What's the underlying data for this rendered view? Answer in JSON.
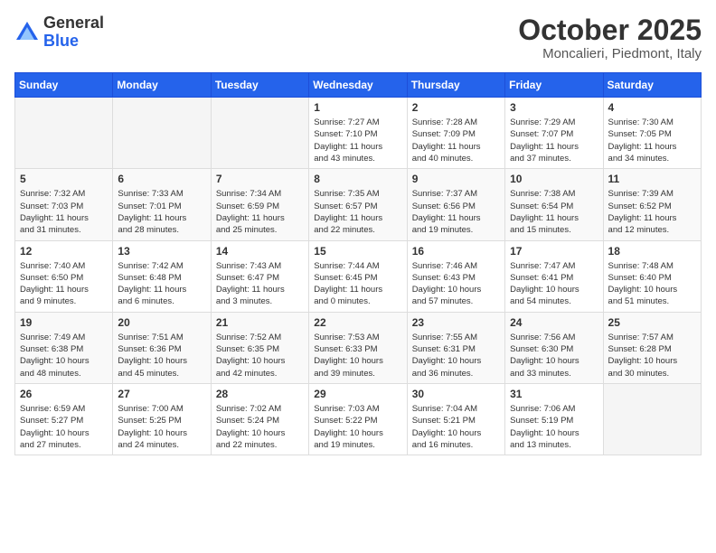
{
  "header": {
    "logo": {
      "general": "General",
      "blue": "Blue"
    },
    "title": "October 2025",
    "subtitle": "Moncalieri, Piedmont, Italy"
  },
  "days_of_week": [
    "Sunday",
    "Monday",
    "Tuesday",
    "Wednesday",
    "Thursday",
    "Friday",
    "Saturday"
  ],
  "weeks": [
    [
      {
        "day": "",
        "info": ""
      },
      {
        "day": "",
        "info": ""
      },
      {
        "day": "",
        "info": ""
      },
      {
        "day": "1",
        "info": "Sunrise: 7:27 AM\nSunset: 7:10 PM\nDaylight: 11 hours\nand 43 minutes."
      },
      {
        "day": "2",
        "info": "Sunrise: 7:28 AM\nSunset: 7:09 PM\nDaylight: 11 hours\nand 40 minutes."
      },
      {
        "day": "3",
        "info": "Sunrise: 7:29 AM\nSunset: 7:07 PM\nDaylight: 11 hours\nand 37 minutes."
      },
      {
        "day": "4",
        "info": "Sunrise: 7:30 AM\nSunset: 7:05 PM\nDaylight: 11 hours\nand 34 minutes."
      }
    ],
    [
      {
        "day": "5",
        "info": "Sunrise: 7:32 AM\nSunset: 7:03 PM\nDaylight: 11 hours\nand 31 minutes."
      },
      {
        "day": "6",
        "info": "Sunrise: 7:33 AM\nSunset: 7:01 PM\nDaylight: 11 hours\nand 28 minutes."
      },
      {
        "day": "7",
        "info": "Sunrise: 7:34 AM\nSunset: 6:59 PM\nDaylight: 11 hours\nand 25 minutes."
      },
      {
        "day": "8",
        "info": "Sunrise: 7:35 AM\nSunset: 6:57 PM\nDaylight: 11 hours\nand 22 minutes."
      },
      {
        "day": "9",
        "info": "Sunrise: 7:37 AM\nSunset: 6:56 PM\nDaylight: 11 hours\nand 19 minutes."
      },
      {
        "day": "10",
        "info": "Sunrise: 7:38 AM\nSunset: 6:54 PM\nDaylight: 11 hours\nand 15 minutes."
      },
      {
        "day": "11",
        "info": "Sunrise: 7:39 AM\nSunset: 6:52 PM\nDaylight: 11 hours\nand 12 minutes."
      }
    ],
    [
      {
        "day": "12",
        "info": "Sunrise: 7:40 AM\nSunset: 6:50 PM\nDaylight: 11 hours\nand 9 minutes."
      },
      {
        "day": "13",
        "info": "Sunrise: 7:42 AM\nSunset: 6:48 PM\nDaylight: 11 hours\nand 6 minutes."
      },
      {
        "day": "14",
        "info": "Sunrise: 7:43 AM\nSunset: 6:47 PM\nDaylight: 11 hours\nand 3 minutes."
      },
      {
        "day": "15",
        "info": "Sunrise: 7:44 AM\nSunset: 6:45 PM\nDaylight: 11 hours\nand 0 minutes."
      },
      {
        "day": "16",
        "info": "Sunrise: 7:46 AM\nSunset: 6:43 PM\nDaylight: 10 hours\nand 57 minutes."
      },
      {
        "day": "17",
        "info": "Sunrise: 7:47 AM\nSunset: 6:41 PM\nDaylight: 10 hours\nand 54 minutes."
      },
      {
        "day": "18",
        "info": "Sunrise: 7:48 AM\nSunset: 6:40 PM\nDaylight: 10 hours\nand 51 minutes."
      }
    ],
    [
      {
        "day": "19",
        "info": "Sunrise: 7:49 AM\nSunset: 6:38 PM\nDaylight: 10 hours\nand 48 minutes."
      },
      {
        "day": "20",
        "info": "Sunrise: 7:51 AM\nSunset: 6:36 PM\nDaylight: 10 hours\nand 45 minutes."
      },
      {
        "day": "21",
        "info": "Sunrise: 7:52 AM\nSunset: 6:35 PM\nDaylight: 10 hours\nand 42 minutes."
      },
      {
        "day": "22",
        "info": "Sunrise: 7:53 AM\nSunset: 6:33 PM\nDaylight: 10 hours\nand 39 minutes."
      },
      {
        "day": "23",
        "info": "Sunrise: 7:55 AM\nSunset: 6:31 PM\nDaylight: 10 hours\nand 36 minutes."
      },
      {
        "day": "24",
        "info": "Sunrise: 7:56 AM\nSunset: 6:30 PM\nDaylight: 10 hours\nand 33 minutes."
      },
      {
        "day": "25",
        "info": "Sunrise: 7:57 AM\nSunset: 6:28 PM\nDaylight: 10 hours\nand 30 minutes."
      }
    ],
    [
      {
        "day": "26",
        "info": "Sunrise: 6:59 AM\nSunset: 5:27 PM\nDaylight: 10 hours\nand 27 minutes."
      },
      {
        "day": "27",
        "info": "Sunrise: 7:00 AM\nSunset: 5:25 PM\nDaylight: 10 hours\nand 24 minutes."
      },
      {
        "day": "28",
        "info": "Sunrise: 7:02 AM\nSunset: 5:24 PM\nDaylight: 10 hours\nand 22 minutes."
      },
      {
        "day": "29",
        "info": "Sunrise: 7:03 AM\nSunset: 5:22 PM\nDaylight: 10 hours\nand 19 minutes."
      },
      {
        "day": "30",
        "info": "Sunrise: 7:04 AM\nSunset: 5:21 PM\nDaylight: 10 hours\nand 16 minutes."
      },
      {
        "day": "31",
        "info": "Sunrise: 7:06 AM\nSunset: 5:19 PM\nDaylight: 10 hours\nand 13 minutes."
      },
      {
        "day": "",
        "info": ""
      }
    ]
  ]
}
